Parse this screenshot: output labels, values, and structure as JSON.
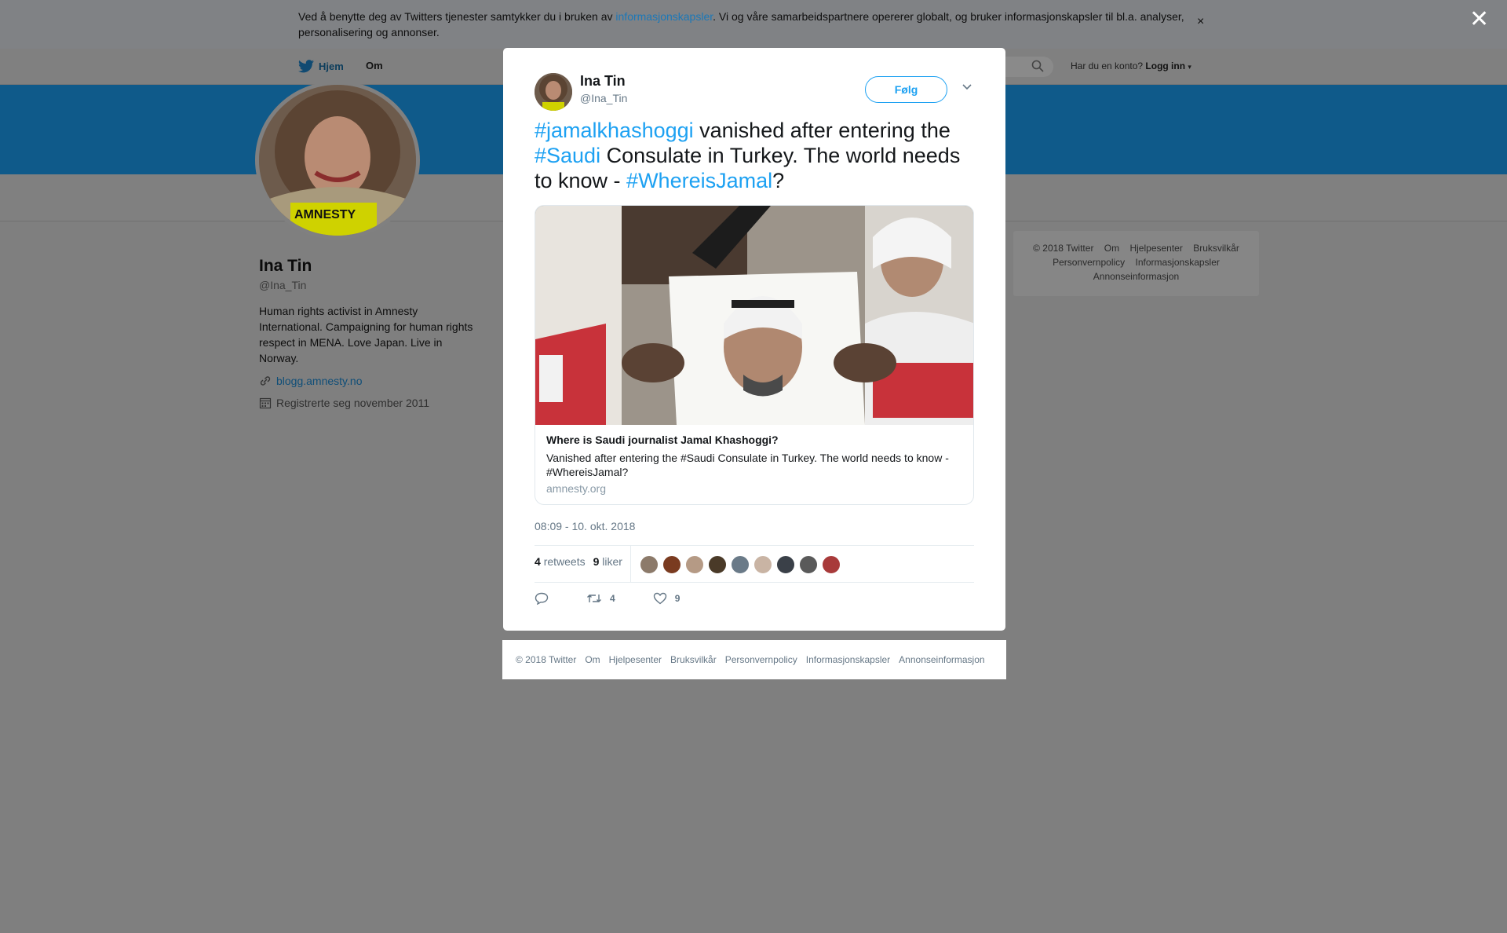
{
  "cookie_banner": {
    "text_before": "Ved å benytte deg av Twitters tjenester samtykker du i bruken av ",
    "link": "informasjonskapsler",
    "text_after": ". Vi og våre samarbeidspartnere opererer globalt, og bruker informasjonskapsler til bl.a. analyser, personalisering og annonser.",
    "close": "×"
  },
  "overlay_close": "✕",
  "nav": {
    "home": "Hjem",
    "about": "Om",
    "account_prompt": "Har du en konto?",
    "login": "Logg inn"
  },
  "profile": {
    "name": "Ina Tin",
    "handle": "@Ina_Tin",
    "bio": "Human rights activist in Amnesty International. Campaigning for human rights respect in MENA. Love Japan. Live in Norway.",
    "link": "blogg.amnesty.no",
    "joined": "Registrerte seg november 2011",
    "avatar_badge": "AMNESTY"
  },
  "side_footer": {
    "items": [
      "© 2018 Twitter",
      "Om",
      "Hjelpesenter",
      "Bruksvilkår",
      "Personvernpolicy",
      "Informasjonskapsler",
      "Annonseinformasjon"
    ]
  },
  "tweet": {
    "name": "Ina Tin",
    "handle": "@Ina_Tin",
    "follow": "Følg",
    "parts": {
      "tag1": "#jamalkhashoggi",
      "t1": " vanished after entering the ",
      "tag2": "#Saudi",
      "t2": " Consulate in Turkey. The world needs to know - ",
      "tag3": "#WhereisJamal",
      "t3": "?"
    },
    "card": {
      "title": "Where is Saudi journalist Jamal Khashoggi?",
      "description": "Vanished after entering the #Saudi Consulate in Turkey. The world needs to know - #WhereisJamal?",
      "domain": "amnesty.org"
    },
    "timestamp": "08:09 - 10. okt. 2018",
    "retweets_count": "4",
    "retweets_label": "retweets",
    "likes_count": "9",
    "likes_label": "liker",
    "liker_avatar_colors": [
      "#8c7a6a",
      "#7a3b20",
      "#b59a85",
      "#4a3a28",
      "#6a7a88",
      "#c9b4a4",
      "#3a4048",
      "#5a5a5a",
      "#a83a3a"
    ],
    "actions": {
      "retweet_count": "4",
      "like_count": "9"
    }
  },
  "modal_footer": {
    "items": [
      "© 2018 Twitter",
      "Om",
      "Hjelpesenter",
      "Bruksvilkår",
      "Personvernpolicy",
      "Informasjonskapsler",
      "Annonseinformasjon"
    ]
  },
  "colors": {
    "accent": "#1da1f2",
    "banner": "#1a8cd8",
    "overlay": "#7f7f7f"
  }
}
